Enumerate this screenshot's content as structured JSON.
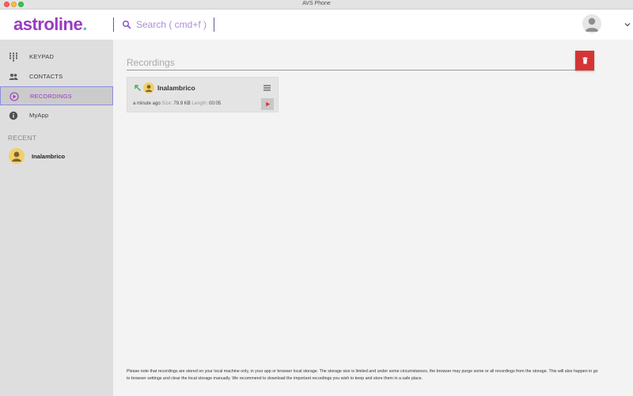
{
  "window": {
    "title": "AVS Phone"
  },
  "header": {
    "logo_main": "astroline",
    "logo_dot": ".",
    "search_placeholder": "Search ( cmd+f )"
  },
  "sidebar": {
    "items": [
      {
        "label": "KEYPAD",
        "icon": "keypad-icon"
      },
      {
        "label": "CONTACTS",
        "icon": "contacts-icon"
      },
      {
        "label": "RECORDINGS",
        "icon": "recordings-icon",
        "active": true
      },
      {
        "label": "MyApp",
        "icon": "info-icon"
      }
    ],
    "recent_title": "RECENT",
    "recent": [
      {
        "name": "Inalambrico"
      }
    ]
  },
  "main": {
    "title": "Recordings",
    "recordings": [
      {
        "name": "Inalambrico",
        "direction": "outgoing",
        "time": "a minute ago",
        "size_label": "Size:",
        "size": "79.9 KB",
        "length_label": "Length:",
        "length": "00:05"
      }
    ],
    "footnote": "Please note that recordings are stored on your local machine only, in your app or browser local storage. The storage size is limited and under some circumstances, the browser may purge some or all recordings from the storage. This will also happen in go to browser settings and clear the local storage manually. We recommend to download the important recordings you wish to keep and store them in a safe place."
  },
  "colors": {
    "brand": "#9b3ac2",
    "accent_green": "#5ac2a0",
    "delete_red": "#d63434",
    "play_red": "#e03030",
    "avatar_yellow": "#f2cf6a"
  }
}
